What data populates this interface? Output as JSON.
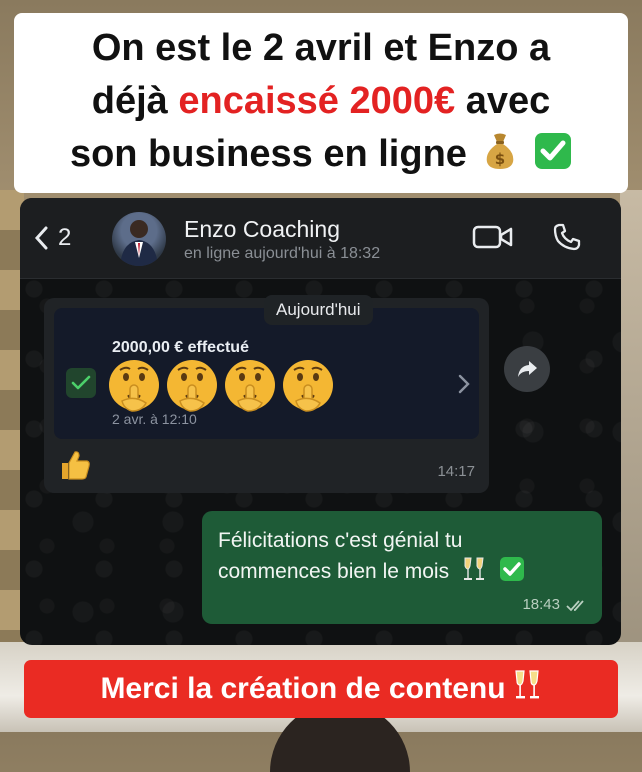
{
  "caption_top": {
    "line1": "On est le 2 avril et Enzo a",
    "line2_pre": "déjà ",
    "line2_highlight": "encaissé 2000€",
    "line2_post": " avec",
    "line3": "son business en ligne"
  },
  "chat": {
    "header": {
      "unread_count": "2",
      "contact_name": "Enzo Coaching",
      "status": "en ligne aujourd'hui à 18:32",
      "icons": [
        "back-chevron-icon",
        "video-call-icon",
        "phone-icon"
      ]
    },
    "date_separator": "Aujourd'hui",
    "incoming_message": {
      "payment_amount": "2000,00 € effectué",
      "payment_date": "2 avr. à 12:10",
      "reaction": "thumbs-up-emoji",
      "time": "14:17"
    },
    "outgoing_message": {
      "text_line1": "Félicitations c'est génial tu",
      "text_line2": "commences bien le mois",
      "time": "18:43"
    }
  },
  "caption_bottom": {
    "text": "Merci la création de contenu"
  },
  "colors": {
    "highlight_red": "#e32222",
    "bottom_banner": "#ea2b23",
    "outgoing_bubble": "#1e5b37",
    "check_green": "#2fb94c"
  }
}
